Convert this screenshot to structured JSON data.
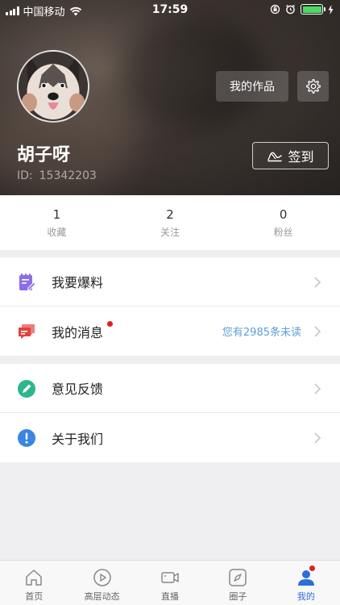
{
  "status_bar": {
    "carrier": "中国移动",
    "time": "17:59"
  },
  "profile": {
    "username": "胡子呀",
    "id_label": "ID:",
    "id_value": "15342203",
    "works_button": "我的作品",
    "checkin_button": "签到"
  },
  "stats": [
    {
      "value": "1",
      "label": "收藏"
    },
    {
      "value": "2",
      "label": "关注"
    },
    {
      "value": "0",
      "label": "粉丝"
    }
  ],
  "menu_group_1": [
    {
      "label": "我要爆料",
      "icon": "notepad-edit-icon",
      "color": "#8b6ee6"
    },
    {
      "label": "我的消息",
      "icon": "chat-bubbles-icon",
      "color": "#e24141",
      "hint": "您有2985条未读",
      "has_dot": true
    }
  ],
  "menu_group_2": [
    {
      "label": "意见反馈",
      "icon": "pencil-circle-icon",
      "color": "#2db68c"
    },
    {
      "label": "关于我们",
      "icon": "info-circle-icon",
      "color": "#3a86e0"
    }
  ],
  "tabs": [
    {
      "label": "首页",
      "icon": "home-icon"
    },
    {
      "label": "高层动态",
      "icon": "play-circle-icon"
    },
    {
      "label": "直播",
      "icon": "video-camera-icon"
    },
    {
      "label": "圈子",
      "icon": "compass-icon"
    },
    {
      "label": "我的",
      "icon": "user-icon",
      "active": true
    }
  ],
  "colors": {
    "accent": "#2d6ed6",
    "badge": "#e02020",
    "hint": "#5b9ed9"
  }
}
